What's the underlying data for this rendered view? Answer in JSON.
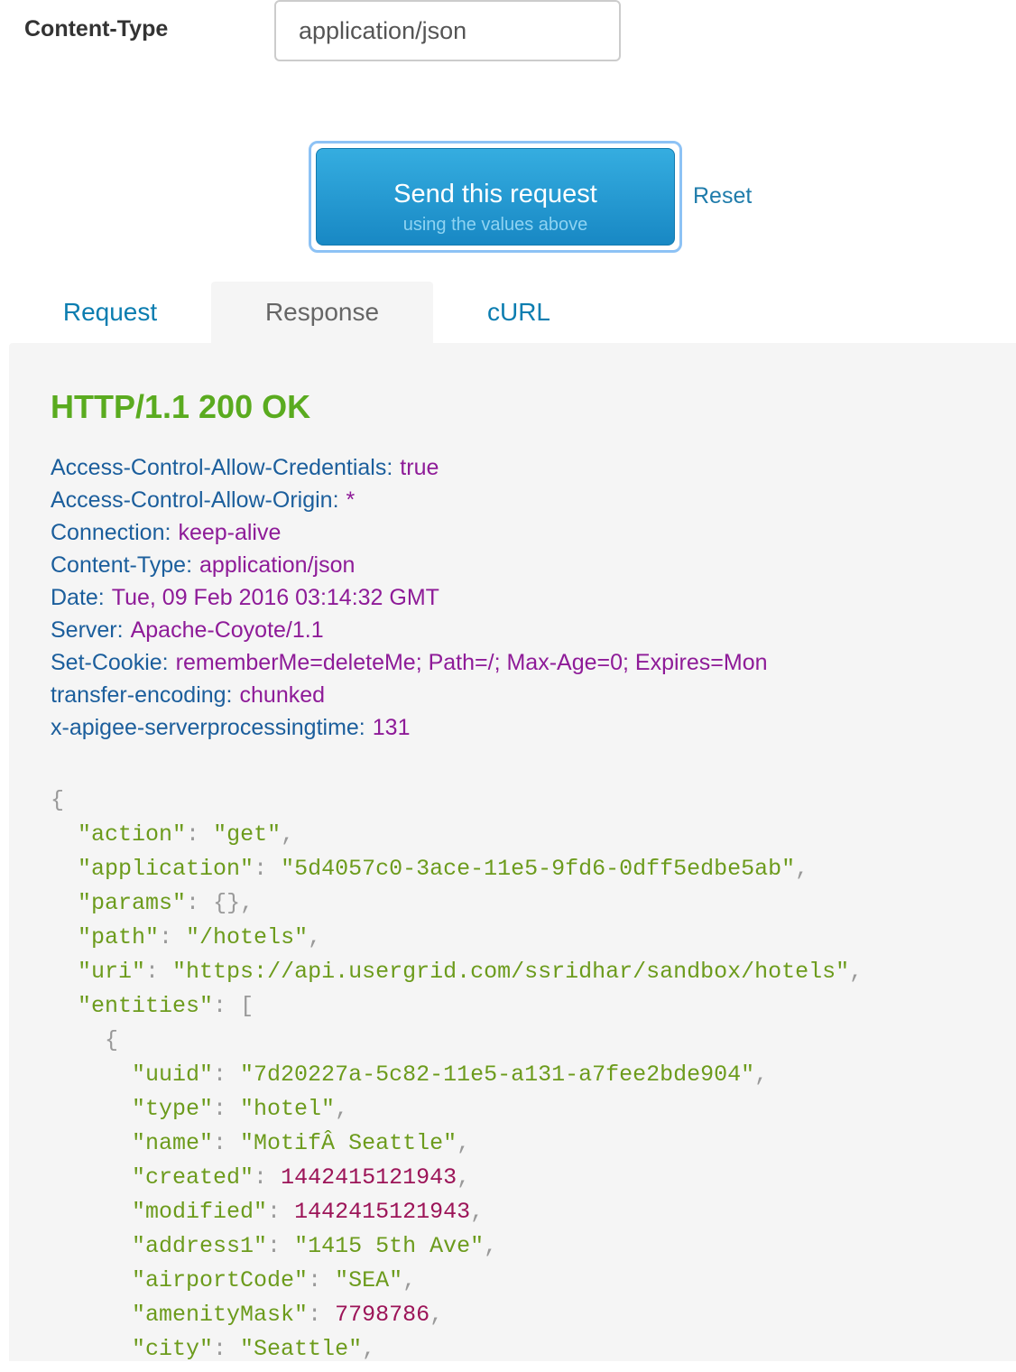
{
  "content_type": {
    "label": "Content-Type",
    "value": "application/json"
  },
  "send": {
    "title": "Send this request",
    "subtitle": "using the values above",
    "reset_label": "Reset"
  },
  "tabs": [
    {
      "label": "Request"
    },
    {
      "label": "Response"
    },
    {
      "label": "cURL"
    }
  ],
  "response": {
    "status": "HTTP/1.1 200 OK",
    "headers": [
      {
        "key": "Access-Control-Allow-Credentials:",
        "value": "true"
      },
      {
        "key": "Access-Control-Allow-Origin:",
        "value": "*"
      },
      {
        "key": "Connection:",
        "value": "keep-alive"
      },
      {
        "key": "Content-Type:",
        "value": "application/json"
      },
      {
        "key": "Date:",
        "value": "Tue, 09 Feb 2016 03:14:32 GMT"
      },
      {
        "key": "Server:",
        "value": "Apache-Coyote/1.1"
      },
      {
        "key": "Set-Cookie:",
        "value": "rememberMe=deleteMe; Path=/; Max-Age=0; Expires=Mon"
      },
      {
        "key": "transfer-encoding:",
        "value": "chunked"
      },
      {
        "key": "x-apigee-serverprocessingtime:",
        "value": "131"
      }
    ],
    "body_lines": [
      {
        "indent": "",
        "open": "{"
      },
      {
        "indent": "  ",
        "key": "\"action\"",
        "value": "\"get\"",
        "vtype": "s",
        "trail": ","
      },
      {
        "indent": "  ",
        "key": "\"application\"",
        "value": "\"5d4057c0-3ace-11e5-9fd6-0dff5edbe5ab\"",
        "vtype": "s",
        "trail": ","
      },
      {
        "indent": "  ",
        "key": "\"params\"",
        "value": "{}",
        "vtype": "p",
        "trail": ","
      },
      {
        "indent": "  ",
        "key": "\"path\"",
        "value": "\"/hotels\"",
        "vtype": "s",
        "trail": ","
      },
      {
        "indent": "  ",
        "key": "\"uri\"",
        "value": "\"https://api.usergrid.com/ssridhar/sandbox/hotels\"",
        "vtype": "s",
        "trail": ","
      },
      {
        "indent": "  ",
        "key": "\"entities\"",
        "value": "[",
        "vtype": "p",
        "trail": ""
      },
      {
        "indent": "    ",
        "open": "{"
      },
      {
        "indent": "      ",
        "key": "\"uuid\"",
        "value": "\"7d20227a-5c82-11e5-a131-a7fee2bde904\"",
        "vtype": "s",
        "trail": ","
      },
      {
        "indent": "      ",
        "key": "\"type\"",
        "value": "\"hotel\"",
        "vtype": "s",
        "trail": ","
      },
      {
        "indent": "      ",
        "key": "\"name\"",
        "value": "\"MotifÂ Seattle\"",
        "vtype": "s",
        "trail": ","
      },
      {
        "indent": "      ",
        "key": "\"created\"",
        "value": "1442415121943",
        "vtype": "n",
        "trail": ","
      },
      {
        "indent": "      ",
        "key": "\"modified\"",
        "value": "1442415121943",
        "vtype": "n",
        "trail": ","
      },
      {
        "indent": "      ",
        "key": "\"address1\"",
        "value": "\"1415 5th Ave\"",
        "vtype": "s",
        "trail": ","
      },
      {
        "indent": "      ",
        "key": "\"airportCode\"",
        "value": "\"SEA\"",
        "vtype": "s",
        "trail": ","
      },
      {
        "indent": "      ",
        "key": "\"amenityMask\"",
        "value": "7798786",
        "vtype": "n",
        "trail": ","
      },
      {
        "indent": "      ",
        "key": "\"city\"",
        "value": "\"Seattle\"",
        "vtype": "s",
        "trail": ","
      }
    ]
  },
  "colors": {
    "status_green": "#5aab1f",
    "header_key": "#1b5e9c",
    "header_value": "#8e1b98",
    "json_string": "#6c9b1c",
    "json_number": "#9c1458",
    "link": "#0b7db0"
  }
}
